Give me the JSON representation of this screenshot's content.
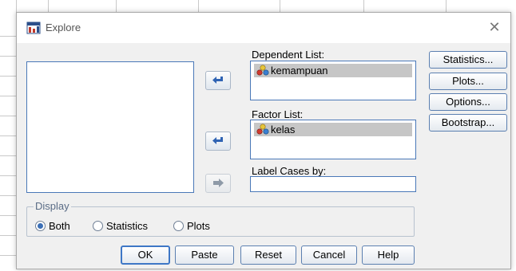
{
  "window": {
    "title": "Explore"
  },
  "labels": {
    "dependent_list": "Dependent List:",
    "factor_list": "Factor List:",
    "label_cases": "Label Cases by:"
  },
  "dependent_items": [
    "kemampuan"
  ],
  "factor_items": [
    "kelas"
  ],
  "side_buttons": {
    "statistics": "Statistics...",
    "plots": "Plots...",
    "options": "Options...",
    "bootstrap": "Bootstrap..."
  },
  "display": {
    "title": "Display",
    "options": [
      {
        "label": "Both",
        "selected": true
      },
      {
        "label": "Statistics",
        "selected": false
      },
      {
        "label": "Plots",
        "selected": false
      }
    ]
  },
  "buttons": {
    "ok": "OK",
    "paste": "Paste",
    "reset": "Reset",
    "cancel": "Cancel",
    "help": "Help"
  },
  "colors": {
    "accent": "#3b6fb6",
    "arrow": "#2f63b3",
    "selection": "#c6c6c6"
  }
}
